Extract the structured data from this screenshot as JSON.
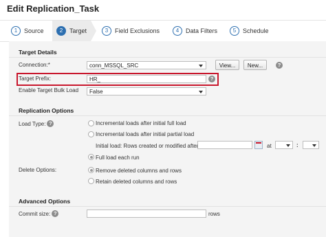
{
  "title": "Edit Replication_Task",
  "tabs": [
    {
      "num": "1",
      "label": "Source"
    },
    {
      "num": "2",
      "label": "Target"
    },
    {
      "num": "3",
      "label": "Field Exclusions"
    },
    {
      "num": "4",
      "label": "Data Filters"
    },
    {
      "num": "5",
      "label": "Schedule"
    }
  ],
  "target_details": {
    "heading": "Target Details",
    "connection_label": "Connection:*",
    "connection_value": "conn_MSSQL_SRC",
    "view_button": "View...",
    "new_button": "New...",
    "prefix_label": "Target Prefix:",
    "prefix_value": "HR_",
    "bulk_label": "Enable Target Bulk Load",
    "bulk_value": "False"
  },
  "replication_options": {
    "heading": "Replication Options",
    "load_type_label": "Load Type:",
    "opt_incremental_full": "Incremental loads after initial full load",
    "opt_incremental_partial": "Incremental loads after initial partial load",
    "initial_load_label": "Initial load: Rows created or modified after",
    "at_label": "at",
    "colon": ":",
    "opt_full_load": "Full load each run",
    "delete_label": "Delete Options:",
    "opt_remove_deleted": "Remove deleted columns and rows",
    "opt_retain_deleted": "Retain deleted columns and rows"
  },
  "advanced_options": {
    "heading": "Advanced Options",
    "commit_label": "Commit size:",
    "commit_value": "",
    "rows_label": "rows"
  },
  "help_glyph": "?",
  "colors": {
    "accent": "#2d6fb0",
    "highlight": "#c8162c",
    "panel": "#f4f4f4"
  }
}
